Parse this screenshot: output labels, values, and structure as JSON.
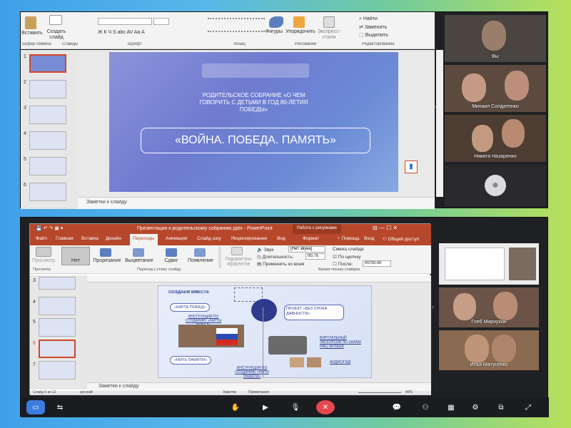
{
  "top": {
    "ribbon": {
      "paste": "Вставить",
      "create_slide": "Создать слайд",
      "clipboard": "Буфер обмена",
      "slides": "Слайды",
      "font": "Шрифт",
      "paragraph": "Абзац",
      "drawing": "Рисование",
      "editing": "Редактирование",
      "shapes": "Фигуры",
      "arrange": "Упорядочить",
      "quick_styles": "Экспресс-стили",
      "find": "Найти",
      "replace": "Заменить",
      "select": "Выделить",
      "font_fmt": "Ж  К  Ч  S  abc  AV  Aa  A"
    },
    "thumb_numbers": [
      "1",
      "2",
      "3",
      "4",
      "5",
      "6"
    ],
    "slide": {
      "heading": "РОДИТЕЛЬСКОЕ СОБРАНИЕ «О ЧЕМ ГОВОРИТЬ С ДЕТЬМИ В ГОД 80-ЛЕТИЯ ПОБЕДЫ»",
      "title": "«ВОЙНА. ПОБЕДА. ПАМЯТЬ»"
    },
    "notes": "Заметки к слайду",
    "participants": [
      "Вы",
      "Михаил Солдатенко",
      "Никита Назаренко"
    ]
  },
  "bottom": {
    "window_title": "Презентация к родительскому собранию.pptx - PowerPoint",
    "drawing_tools": "Работа с рисунками",
    "tabs": [
      "Файл",
      "Главная",
      "Вставка",
      "Дизайн",
      "Переходы",
      "Анимация",
      "Слайд-шоу",
      "Рецензирование",
      "Вид",
      "Формат"
    ],
    "help": "Помощь",
    "signin": "Вход",
    "share": "Общий доступ",
    "ribbon": {
      "preview": "Просмотр",
      "none": "Нет",
      "cut": "Прорезание",
      "fade": "Выцветание",
      "push": "Сдвиг",
      "wipe": "Появление",
      "effect_params": "Параметры эффектов",
      "sound": "Звук",
      "sound_val": "[Нет звука]",
      "duration": "Длительность:",
      "duration_val": "00,75",
      "apply_all": "Применить ко всем",
      "change_slide": "Смена слайда",
      "on_click": "По щелчку",
      "after": "После:",
      "after_val": "00:00,00",
      "group_preview": "Просмотр",
      "group_transition": "Переход к этому слайду",
      "group_timing": "Время показа слайдов"
    },
    "thumb_numbers": [
      "3",
      "4",
      "5",
      "6",
      "7"
    ],
    "slide": {
      "together": "СОЗДАЕМ ВМЕСТЕ",
      "card_pobed": "«КАРТА ПОБЕД»",
      "instr1": "ИНСТРУКЦИЯ ПО СОЗДАНИЮ «КАРТЫ ПОБЕД»",
      "thread": "«НИТЬ ПАМЯТИ»",
      "instr2": "ИНСТРУКЦИЯ ПО СОЗДАНИЮ «НИТИ ПАМЯТИ»",
      "project": "ПРОЕКТ «БЕЗ СРОКА ДАВНОСТИ»",
      "virtual": "ВИРТУАЛЬНЫЙ ЭКСКУРСИИ ПО ЗАЛАМ НАЦ. МУЗЕЕВ",
      "audiogid": "АУДИОГИД"
    },
    "notes": "Заметки к слайду",
    "status_left": "Слайд 6 из 12",
    "status_lang": "русский",
    "status_notes": "Заметки",
    "status_comments": "Примечания",
    "zoom": "40%",
    "participants": [
      "Глеб Мирнухин",
      "Илья Матусенко"
    ]
  }
}
